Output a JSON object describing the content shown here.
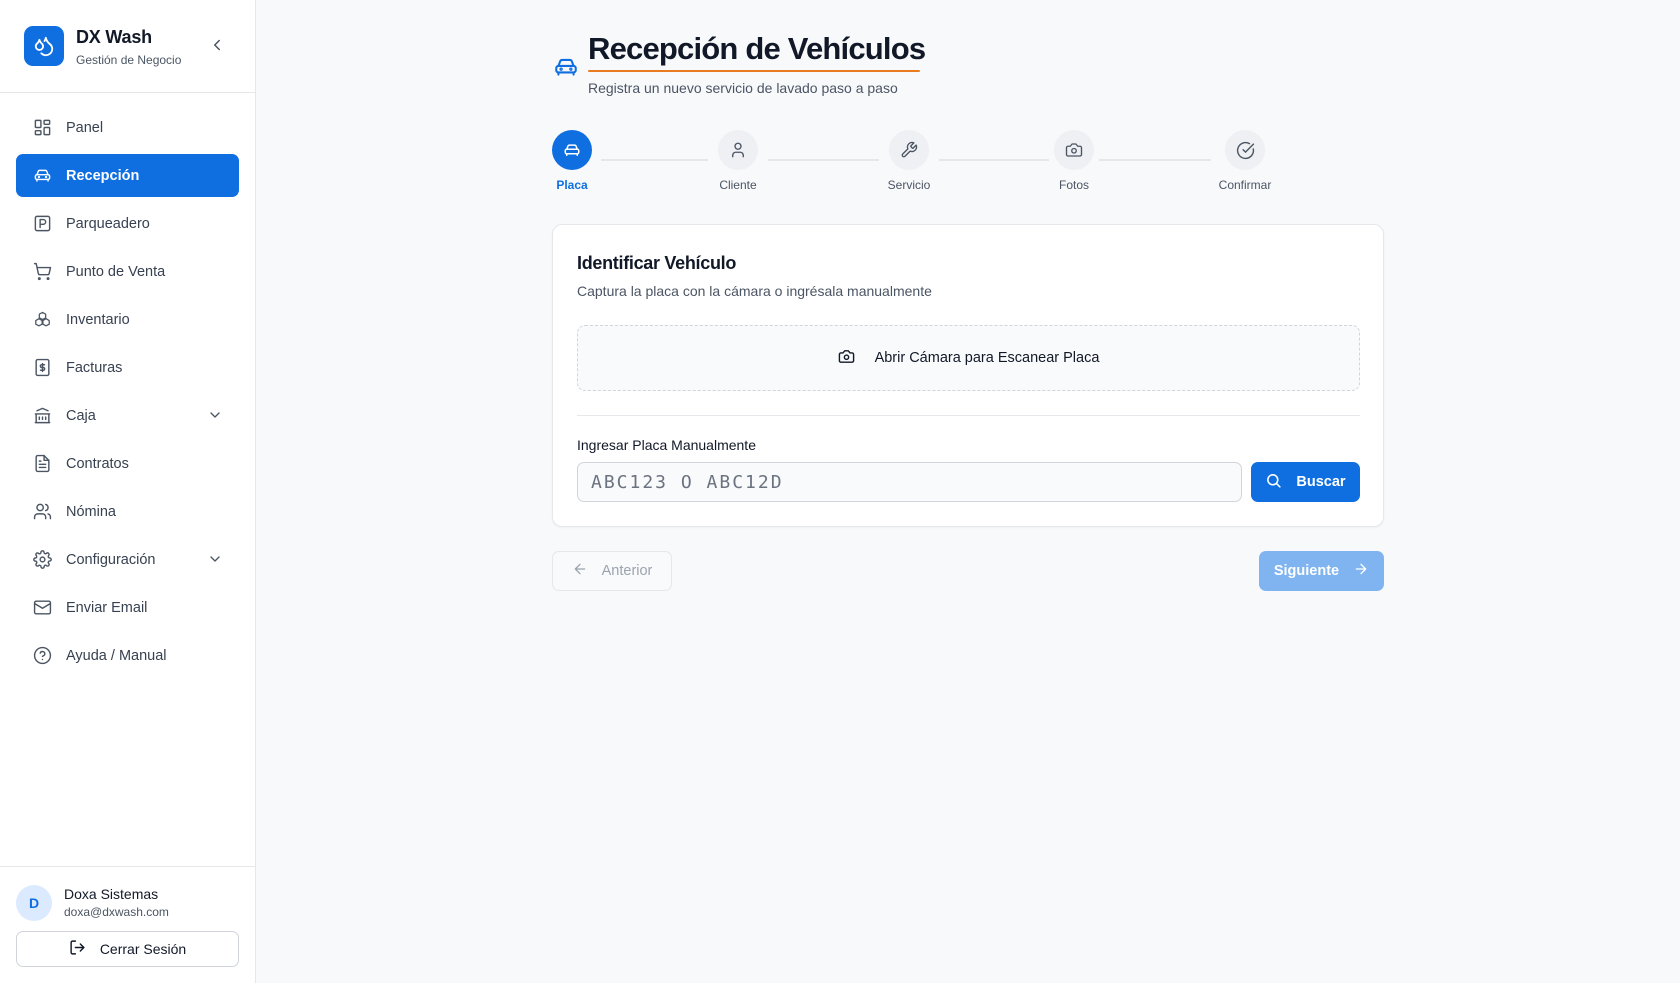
{
  "brand": {
    "name": "DX Wash",
    "subtitle": "Gestión de Negocio"
  },
  "nav": {
    "items": [
      {
        "label": "Panel",
        "icon": "grid-icon"
      },
      {
        "label": "Recepción",
        "icon": "car-icon",
        "active": true
      },
      {
        "label": "Parqueadero",
        "icon": "parking-icon"
      },
      {
        "label": "Punto de Venta",
        "icon": "cart-icon"
      },
      {
        "label": "Inventario",
        "icon": "boxes-icon"
      },
      {
        "label": "Facturas",
        "icon": "receipt-icon"
      },
      {
        "label": "Caja",
        "icon": "bank-icon",
        "expandable": true
      },
      {
        "label": "Contratos",
        "icon": "file-icon"
      },
      {
        "label": "Nómina",
        "icon": "users-icon"
      },
      {
        "label": "Configuración",
        "icon": "gear-icon",
        "expandable": true
      },
      {
        "label": "Enviar Email",
        "icon": "mail-icon"
      },
      {
        "label": "Ayuda / Manual",
        "icon": "help-icon"
      }
    ]
  },
  "user": {
    "initial": "D",
    "name": "Doxa Sistemas",
    "email": "doxa@dxwash.com",
    "logout_label": "Cerrar Sesión"
  },
  "page": {
    "title": "Recepción de Vehículos",
    "subtitle": "Registra un nuevo servicio de lavado paso a paso"
  },
  "stepper": {
    "steps": [
      {
        "label": "Placa",
        "icon": "car-icon",
        "active": true
      },
      {
        "label": "Cliente",
        "icon": "user-icon"
      },
      {
        "label": "Servicio",
        "icon": "wrench-icon"
      },
      {
        "label": "Fotos",
        "icon": "camera-icon"
      },
      {
        "label": "Confirmar",
        "icon": "check-circle-icon"
      }
    ]
  },
  "card": {
    "title": "Identificar Vehículo",
    "subtitle": "Captura la placa con la cámara o ingrésala manualmente",
    "camera_label": "Abrir Cámara para Escanear Placa",
    "manual_label": "Ingresar Placa Manualmente",
    "plate_placeholder": "ABC123 O ABC12D",
    "plate_value": "",
    "search_label": "Buscar"
  },
  "footer": {
    "prev_label": "Anterior",
    "next_label": "Siguiente"
  },
  "colors": {
    "primary": "#0f6fe0",
    "accent": "#ea7b20",
    "disabled": "#7fb4f0"
  }
}
